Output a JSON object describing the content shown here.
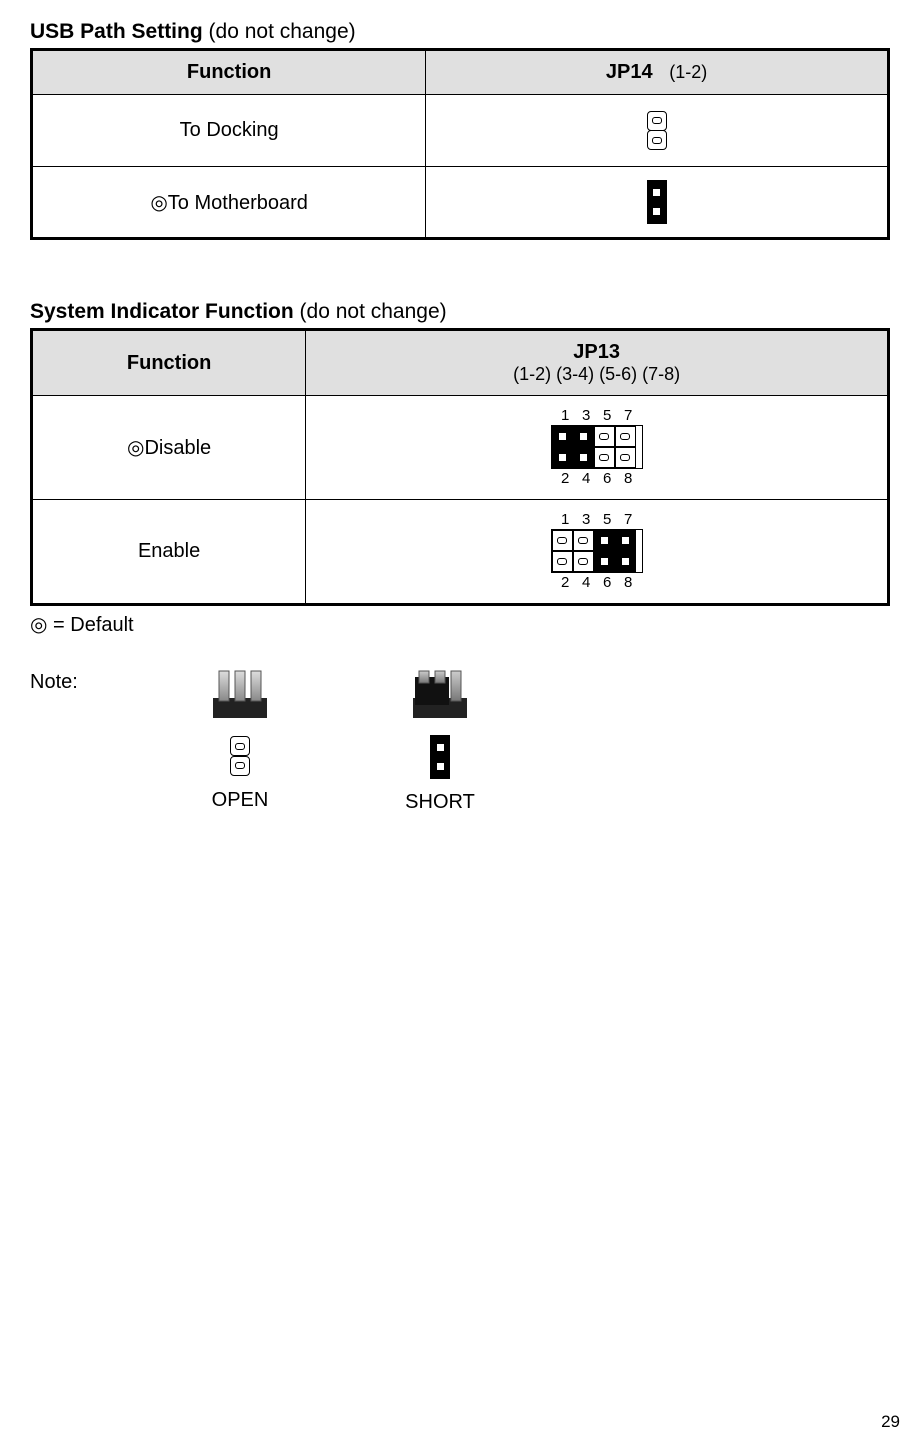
{
  "section1": {
    "title_bold": "USB Path Setting",
    "title_note": " (do not change)",
    "header_function": "Function",
    "header_jumper": "JP14",
    "header_jumper_sub": "(1-2)",
    "rows": [
      {
        "label": "To Docking",
        "default": false,
        "state": "open"
      },
      {
        "label": "To Motherboard",
        "default": true,
        "state": "short"
      }
    ]
  },
  "section2": {
    "title_bold": "System Indicator Function",
    "title_note": " (do not change)",
    "header_function": "Function",
    "header_jumper": "JP13",
    "header_jumper_sub": "(1-2) (3-4) (5-6) (7-8)",
    "pin_labels_top": [
      "1",
      "3",
      "5",
      "7"
    ],
    "pin_labels_bottom": [
      "2",
      "4",
      "6",
      "8"
    ],
    "rows": [
      {
        "label": "Disable",
        "default": true,
        "pins_top": [
          "short",
          "short",
          "open",
          "open"
        ],
        "pins_bottom": [
          "short",
          "short",
          "open",
          "open"
        ]
      },
      {
        "label": "Enable",
        "default": false,
        "pins_top": [
          "open",
          "open",
          "short",
          "short"
        ],
        "pins_bottom": [
          "open",
          "open",
          "short",
          "short"
        ]
      }
    ]
  },
  "default_symbol": "◎",
  "default_legend": " = Default",
  "note_label": "Note:",
  "note_open": "OPEN",
  "note_short": "SHORT",
  "page_number": "29"
}
